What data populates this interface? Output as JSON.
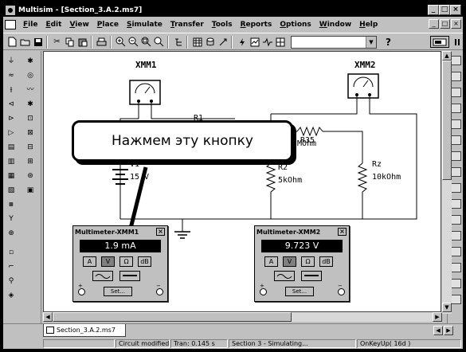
{
  "window": {
    "title": "Multisim - [Section_3.A.2.ms7]",
    "buttons": {
      "minimize": "_",
      "maximize": "□",
      "close": "×"
    }
  },
  "menu": [
    "File",
    "Edit",
    "View",
    "Place",
    "Simulate",
    "Transfer",
    "Tools",
    "Reports",
    "Options",
    "Window",
    "Help"
  ],
  "mdi_buttons": [
    "_",
    "□",
    "×"
  ],
  "toolbar": {
    "combo_value": "",
    "help_symbol": "?"
  },
  "circuit": {
    "xmm1_label": "XMM1",
    "xmm2_label": "XMM2",
    "r1_label": "R1",
    "r35_label": "R35",
    "r35_value": "MOhm",
    "r2_label": "R2",
    "r2_value": "5kOhm",
    "rz_label": "Rz",
    "rz_value": "10kOhm",
    "v1_label": "V1",
    "v1_value": "15 V"
  },
  "callout": {
    "text": "Нажмем эту кнопку"
  },
  "multimeter1": {
    "title": "Multimeter-XMM1",
    "close": "×",
    "display": "1.9  mA",
    "keys": [
      "A",
      "V",
      "Ω",
      "dB"
    ],
    "selected_key": "V",
    "set_label": "Set...",
    "plus": "+",
    "minus": "−"
  },
  "multimeter2": {
    "title": "Multimeter-XMM2",
    "close": "×",
    "display": "9.723 V",
    "keys": [
      "A",
      "V",
      "Ω",
      "dB"
    ],
    "selected_key": "V",
    "set_label": "Set...",
    "plus": "+",
    "minus": "−"
  },
  "tab": {
    "label": "Section_3.A.2.ms7"
  },
  "status": {
    "s1": "",
    "s2": "Circuit modified",
    "s3": "Tran: 0.145 s",
    "s4": "Section  3 - Simulating...",
    "s5": "OnKeyUp( 16d )"
  },
  "icons": {
    "app": "multisim-app-icon",
    "new": "new-file-icon",
    "open": "open-folder-icon",
    "save": "save-icon",
    "cut": "cut-icon",
    "copy": "copy-icon",
    "paste": "paste-icon",
    "print": "print-icon",
    "zoom": "zoom-icon"
  }
}
